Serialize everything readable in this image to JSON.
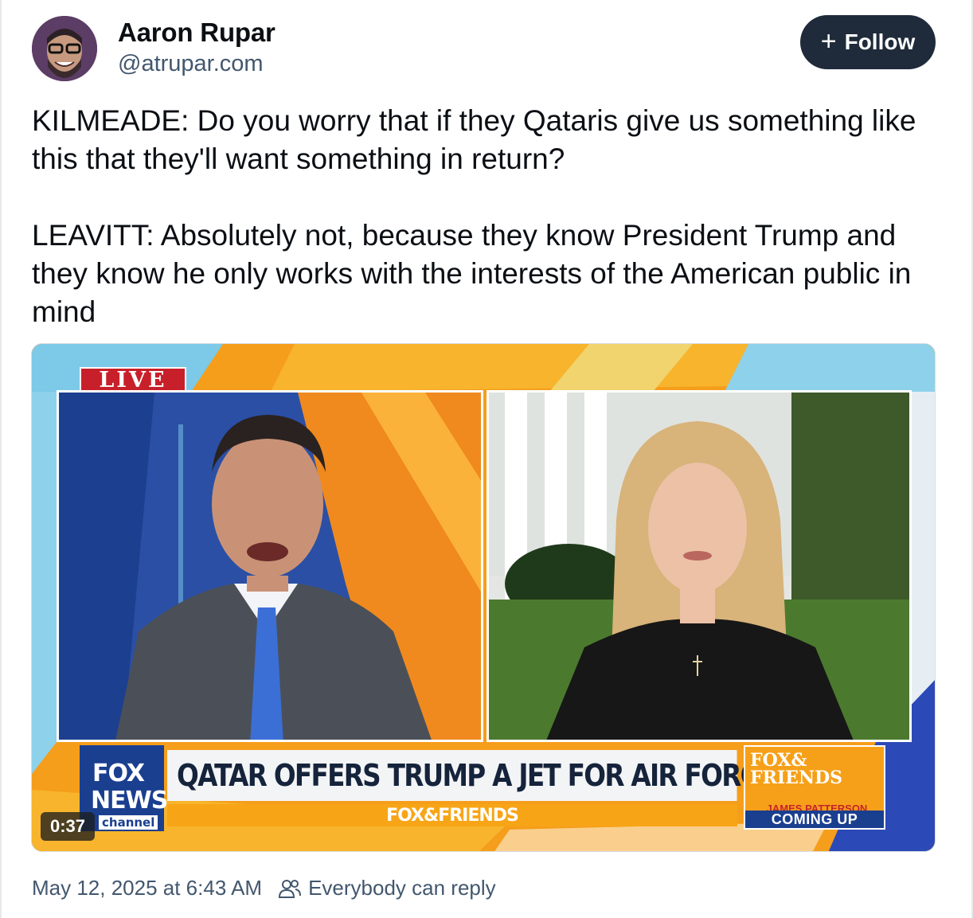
{
  "author": {
    "display_name": "Aaron Rupar",
    "handle": "@atrupar.com"
  },
  "follow_button": {
    "icon": "plus-icon",
    "label": "Follow"
  },
  "post": {
    "paragraphs": [
      "KILMEADE: Do you worry that if they Qataris give us something like this that they'll want something in return?",
      "LEAVITT: Absolutely not, because they know President Trump and they know he only works with the interests of the American public in mind"
    ]
  },
  "video": {
    "duration": "0:37",
    "live_label": "LIVE",
    "network_logo": [
      "FOX",
      "NEWS",
      "channel"
    ],
    "headline": "QATAR OFFERS TRUMP A JET FOR AIR FORCE ONE",
    "ticker": "FOX&FRIENDS",
    "show_box": {
      "brand_line1": "FOX&",
      "brand_line2": "FRIENDS",
      "guest": "JAMES PATTERSON",
      "coming_up": "COMING UP"
    }
  },
  "footer": {
    "date": "May 12, 2025 at 6:43 AM",
    "reply_icon": "people-icon",
    "reply_setting": "Everybody can reply"
  },
  "colors": {
    "follow_bg": "#1f2b3a",
    "muted_text": "#42576e",
    "fox_blue": "#1a3f8f",
    "fox_orange": "#f7a516",
    "live_red": "#c8202a"
  }
}
